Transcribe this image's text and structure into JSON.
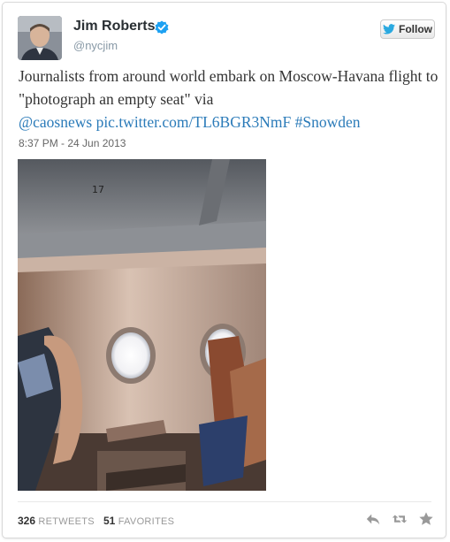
{
  "user": {
    "name": "Jim Roberts",
    "handle": "@nycjim"
  },
  "follow_label": "Follow",
  "tweet": {
    "text_parts": {
      "plain": "Journalists from around world embark on Moscow-Havana flight to \"photograph an empty seat\" via",
      "mention": "@caosnews",
      "link": "pic.twitter.com/TL6BGR3NmF",
      "hashtag": "#Snowden"
    },
    "timestamp": "8:37 PM - 24 Jun 2013",
    "photo_seat_number": "17"
  },
  "stats": {
    "retweets_count": "326",
    "retweets_label": "RETWEETS",
    "favorites_count": "51",
    "favorites_label": "FAVORITES"
  },
  "colors": {
    "link": "#2b7bb9",
    "verified": "#1da1f2"
  },
  "icons": [
    "verified-icon",
    "twitter-bird-icon",
    "reply-icon",
    "retweet-icon",
    "favorite-icon"
  ]
}
